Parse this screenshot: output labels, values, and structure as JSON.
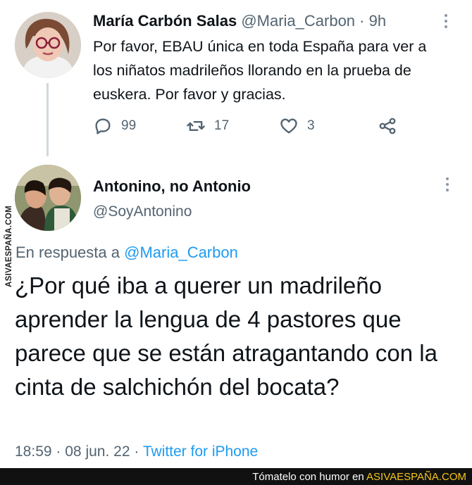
{
  "tweet1": {
    "name": "María Carbón Salas",
    "handle": "@Maria_Carbon",
    "separator": "·",
    "time": "9h",
    "text": "Por favor, EBAU única en toda España para ver a los niñatos madrileños llorando en la prueba de euskera. Por favor y gracias.",
    "stats": {
      "replies": "99",
      "retweets": "17",
      "likes": "3"
    }
  },
  "tweet2": {
    "name": "Antonino, no Antonio",
    "handle": "@SoyAntonino",
    "reply_prefix": "En respuesta a",
    "reply_to": "@Maria_Carbon",
    "text": "¿Por qué iba a querer un madrileño aprender la lengua de 4 pastores que parece que se están atragantando con la cinta de salchichón del bocata?",
    "time": "18:59",
    "date": "08 jun. 22",
    "separator": "·",
    "source": "Twitter for iPhone"
  },
  "watermark": {
    "vertical": "ASIVAESPAÑA.COM",
    "footer_text": "Tómatelo con humor en",
    "footer_site": "ASIVAESPAÑA.COM"
  },
  "colors": {
    "link": "#1d9bf0",
    "muted": "#536471",
    "text": "#0f1419",
    "thread_line": "#cfd9de"
  }
}
